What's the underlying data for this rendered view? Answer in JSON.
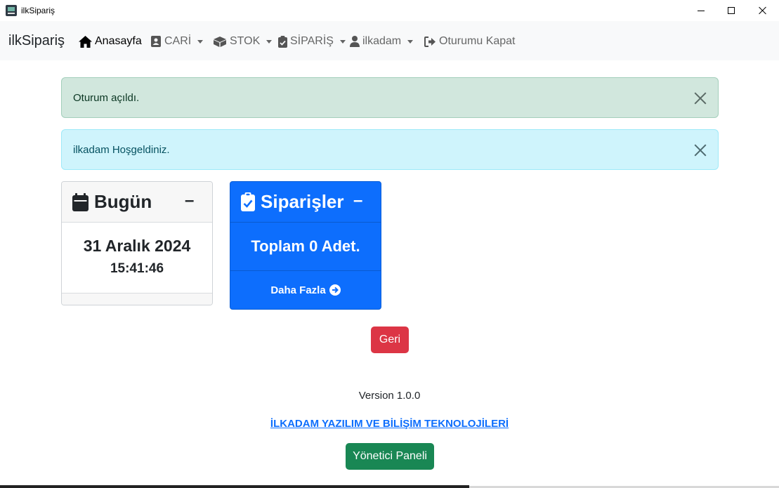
{
  "window": {
    "title": "ilkSipariş"
  },
  "navbar": {
    "brand": "ilkSipariş",
    "items": [
      {
        "label": "Anasayfa",
        "icon": "house-icon",
        "dropdown": false
      },
      {
        "label": "CARİ",
        "icon": "address-card-icon",
        "dropdown": true
      },
      {
        "label": "STOK",
        "icon": "boxes-icon",
        "dropdown": true
      },
      {
        "label": "SİPARİŞ",
        "icon": "clipboard-check-icon",
        "dropdown": true
      },
      {
        "label": "ilkadam",
        "icon": "user-icon",
        "dropdown": true
      },
      {
        "label": "Oturumu Kapat",
        "icon": "sign-out-icon",
        "dropdown": false
      }
    ]
  },
  "alerts": {
    "success": "Oturum açıldı.",
    "info": "ilkadam Hoşgeldiniz."
  },
  "cards": {
    "today": {
      "title": "Bugün",
      "collapse": "–",
      "date": "31 Aralık 2024",
      "time": "15:41:46"
    },
    "orders": {
      "title": "Siparişler",
      "collapse": "–",
      "total": "Toplam 0 Adet.",
      "more": "Daha Fazla"
    }
  },
  "buttons": {
    "back": "Geri",
    "admin": "Yönetici Paneli"
  },
  "footer": {
    "version": "Version 1.0.0",
    "company": "İLKADAM YAZILIM VE BİLİŞİM TEKNOLOJİLERİ"
  },
  "colors": {
    "primary": "#0d6efd",
    "danger": "#dc3545",
    "success": "#198754",
    "alert_success_bg": "#d1e7dd",
    "alert_info_bg": "#cff4fc"
  }
}
